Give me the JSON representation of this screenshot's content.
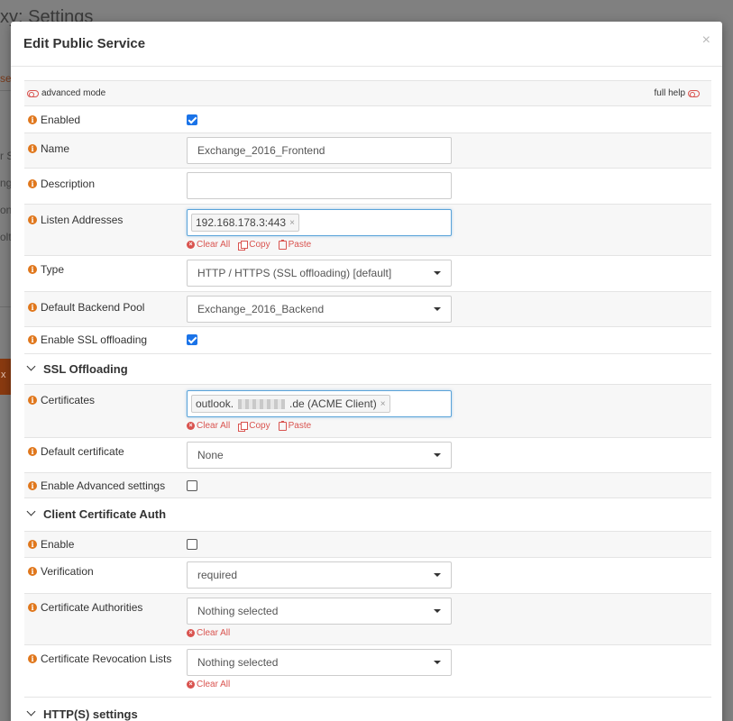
{
  "background": {
    "page_title": "xy: Settings",
    "snippets": [
      "ser",
      "r S",
      "nge",
      "ont",
      "olt",
      "x"
    ]
  },
  "modal": {
    "title": "Edit Public Service",
    "close": "×"
  },
  "form": {
    "advanced_mode": "advanced mode",
    "full_help": "full help",
    "enabled": {
      "label": "Enabled",
      "checked": true
    },
    "name": {
      "label": "Name",
      "value": "Exchange_2016_Frontend"
    },
    "description": {
      "label": "Description",
      "value": ""
    },
    "listen_addresses": {
      "label": "Listen Addresses",
      "tags": [
        "192.168.178.3:443"
      ]
    },
    "type": {
      "label": "Type",
      "value": "HTTP / HTTPS (SSL offloading) [default]"
    },
    "default_backend_pool": {
      "label": "Default Backend Pool",
      "value": "Exchange_2016_Backend"
    },
    "enable_ssl_offloading": {
      "label": "Enable SSL offloading",
      "checked": true
    },
    "certificates": {
      "label": "Certificates",
      "tag_prefix": "outlook.",
      "tag_suffix": ".de (ACME Client)"
    },
    "default_certificate": {
      "label": "Default certificate",
      "value": "None"
    },
    "enable_advanced_settings": {
      "label": "Enable Advanced settings",
      "checked": false
    },
    "enable": {
      "label": "Enable",
      "checked": false
    },
    "verification": {
      "label": "Verification",
      "value": "required"
    },
    "certificate_authorities": {
      "label": "Certificate Authorities",
      "value": "Nothing selected"
    },
    "crl": {
      "label": "Certificate Revocation Lists",
      "value": "Nothing selected"
    }
  },
  "sections": {
    "ssl_offloading": "SSL Offloading",
    "client_cert_auth": "Client Certificate Auth",
    "http_settings": "HTTP(S) settings"
  },
  "actions": {
    "clear_all": "Clear All",
    "copy": "Copy",
    "paste": "Paste"
  },
  "colors": {
    "accent_red": "#d9534f",
    "info_orange": "#e0771c",
    "checkbox_blue": "#1a73e8",
    "focus_blue": "#5aa3d9"
  }
}
